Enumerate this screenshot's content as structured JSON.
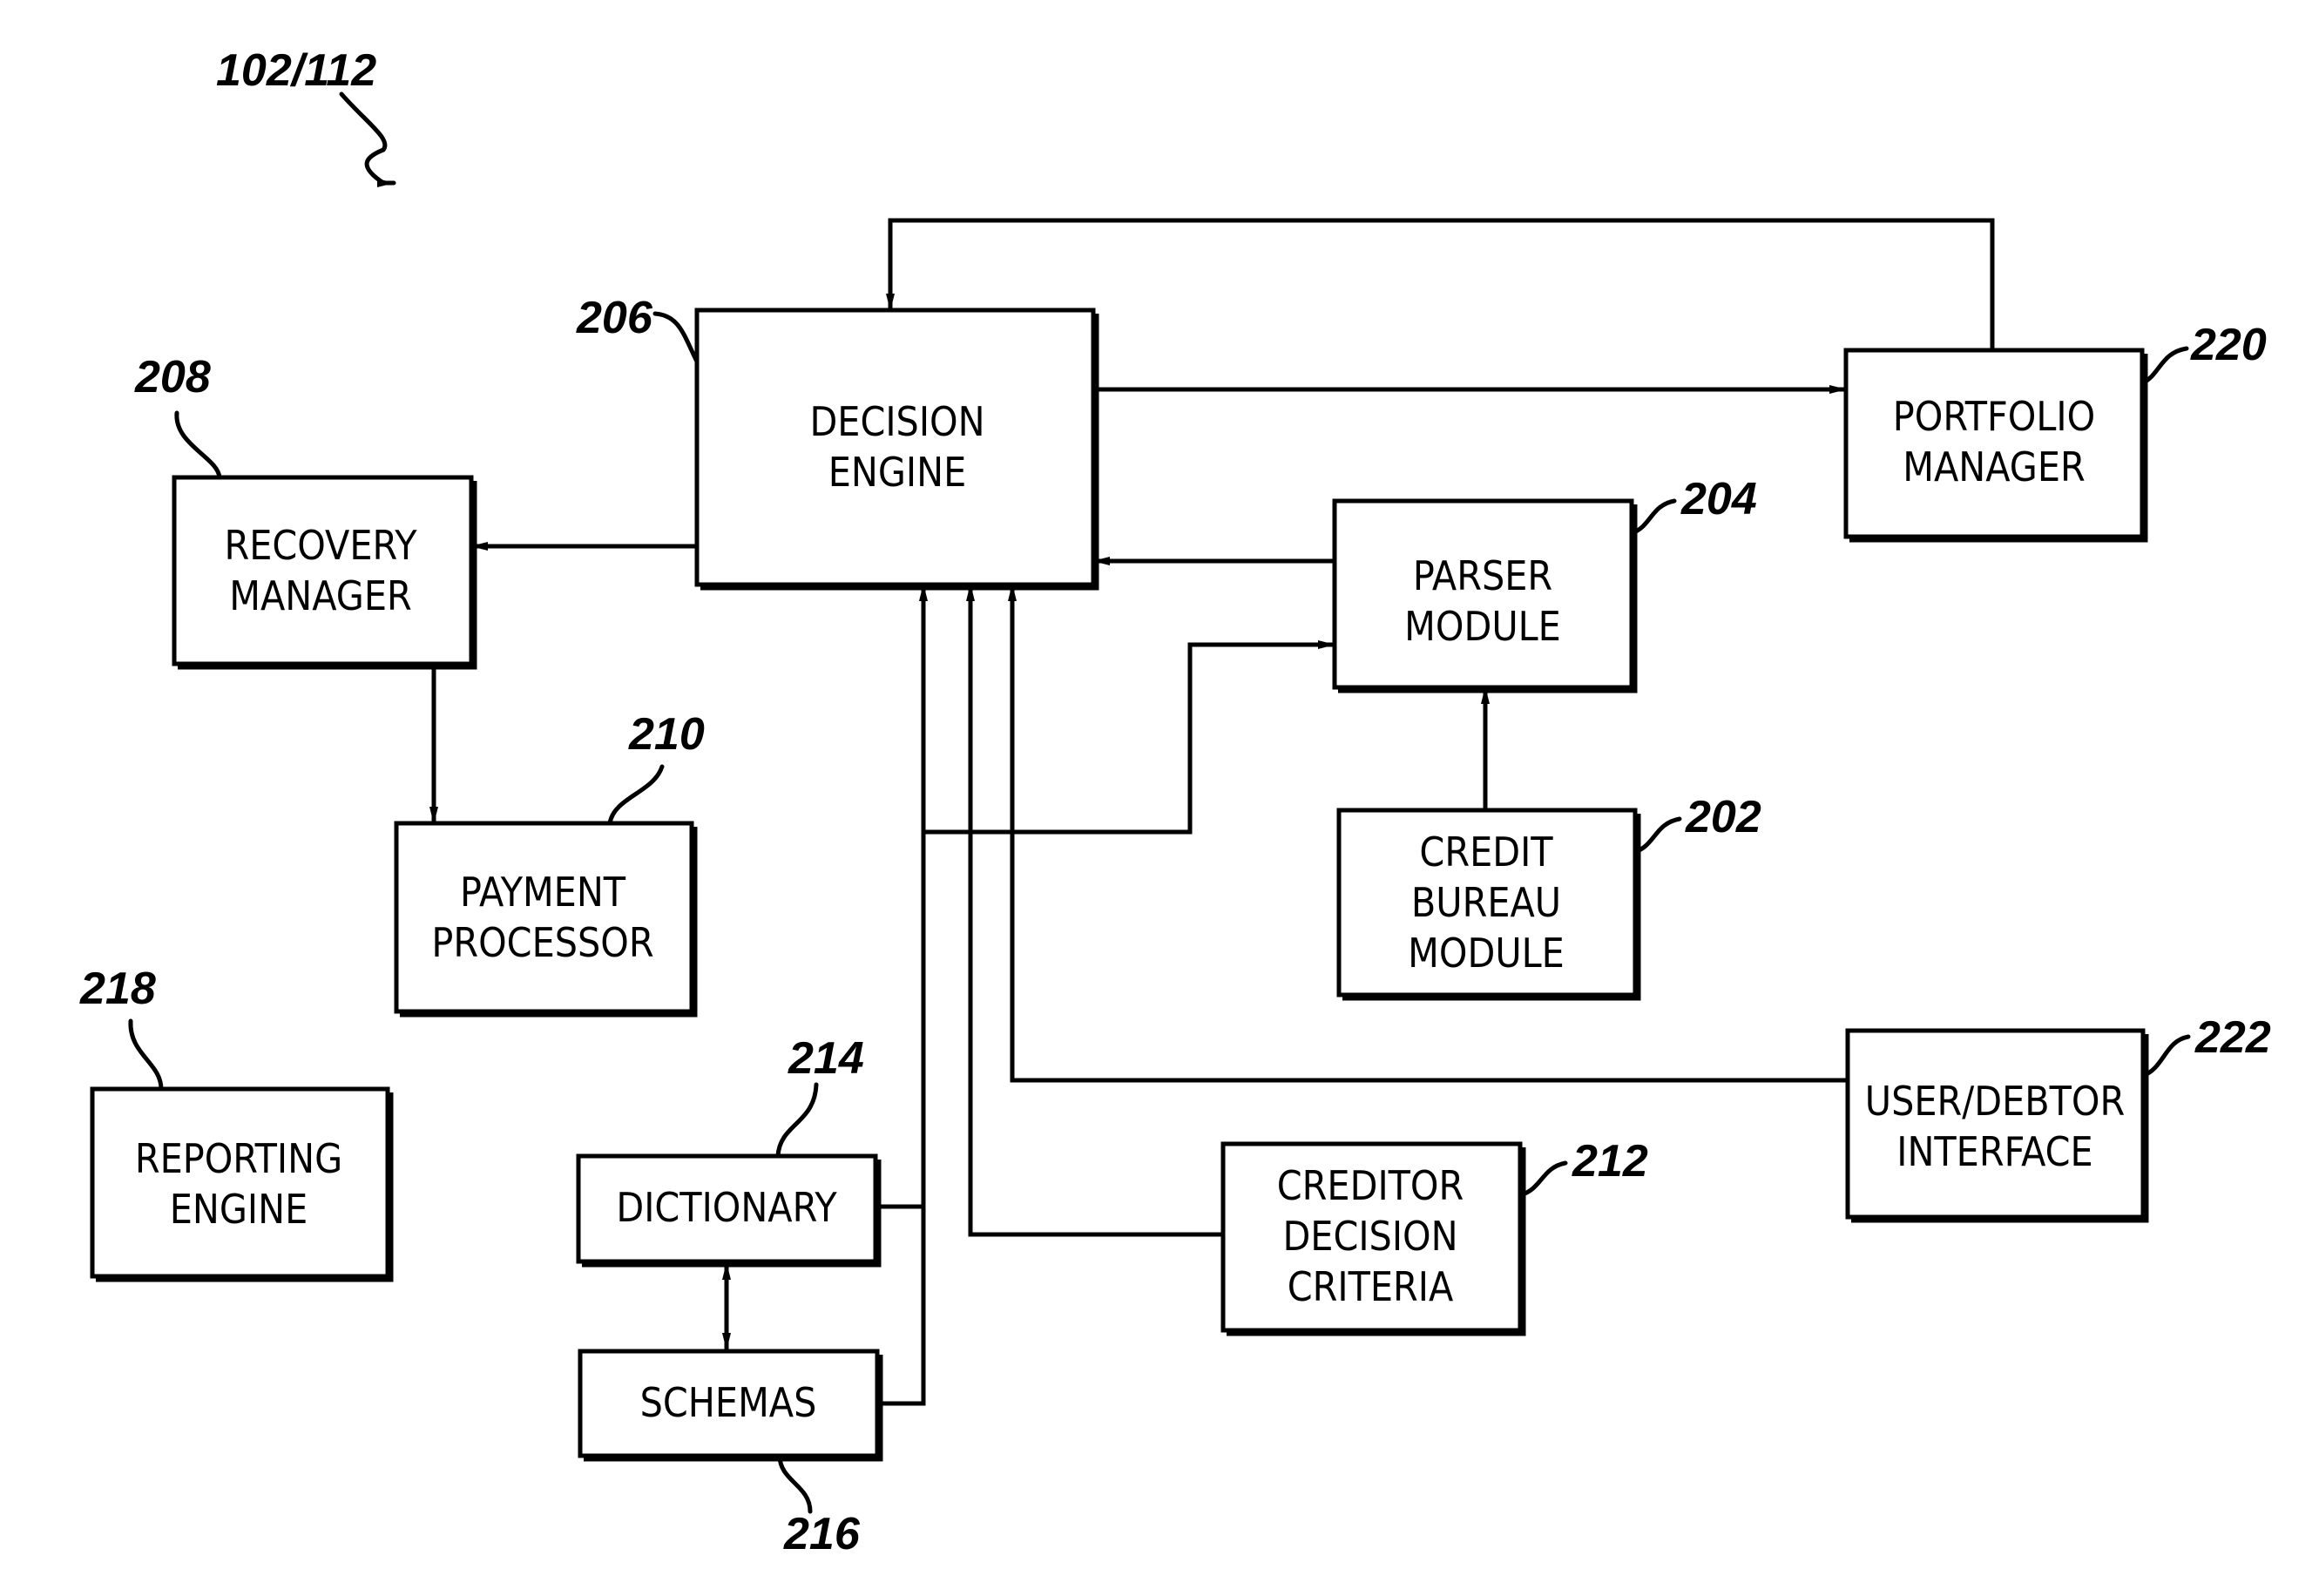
{
  "figure_ref": "102/112",
  "blocks": {
    "decision_engine": {
      "ref": "206",
      "lines": [
        "DECISION",
        "ENGINE"
      ]
    },
    "portfolio_manager": {
      "ref": "220",
      "lines": [
        "PORTFOLIO",
        "MANAGER"
      ]
    },
    "recovery_manager": {
      "ref": "208",
      "lines": [
        "RECOVERY",
        "MANAGER"
      ]
    },
    "parser_module": {
      "ref": "204",
      "lines": [
        "PARSER",
        "MODULE"
      ]
    },
    "credit_bureau_module": {
      "ref": "202",
      "lines": [
        "CREDIT",
        "BUREAU",
        "MODULE"
      ]
    },
    "payment_processor": {
      "ref": "210",
      "lines": [
        "PAYMENT",
        "PROCESSOR"
      ]
    },
    "reporting_engine": {
      "ref": "218",
      "lines": [
        "REPORTING",
        "ENGINE"
      ]
    },
    "dictionary": {
      "ref": "214",
      "lines": [
        "DICTIONARY"
      ]
    },
    "schemas": {
      "ref": "216",
      "lines": [
        "SCHEMAS"
      ]
    },
    "creditor_decision_criteria": {
      "ref": "212",
      "lines": [
        "CREDITOR",
        "DECISION",
        "CRITERIA"
      ]
    },
    "user_debtor_interface": {
      "ref": "222",
      "lines": [
        "USER/DEBTOR",
        "INTERFACE"
      ]
    }
  },
  "connections": [
    {
      "from": "portfolio_manager",
      "to": "decision_engine"
    },
    {
      "from": "decision_engine",
      "to": "portfolio_manager"
    },
    {
      "from": "decision_engine",
      "to": "recovery_manager"
    },
    {
      "from": "parser_module",
      "to": "decision_engine"
    },
    {
      "from": "recovery_manager",
      "to": "payment_processor"
    },
    {
      "from": "credit_bureau_module",
      "to": "parser_module"
    },
    {
      "from": "decision_engine",
      "to": "parser_module"
    },
    {
      "from": "dictionary",
      "to": "decision_engine"
    },
    {
      "from": "schemas",
      "to": "decision_engine"
    },
    {
      "from": "creditor_decision_criteria",
      "to": "decision_engine"
    },
    {
      "from": "user_debtor_interface",
      "to": "decision_engine"
    },
    {
      "from": "dictionary",
      "to": "schemas",
      "bidirectional": true
    }
  ]
}
